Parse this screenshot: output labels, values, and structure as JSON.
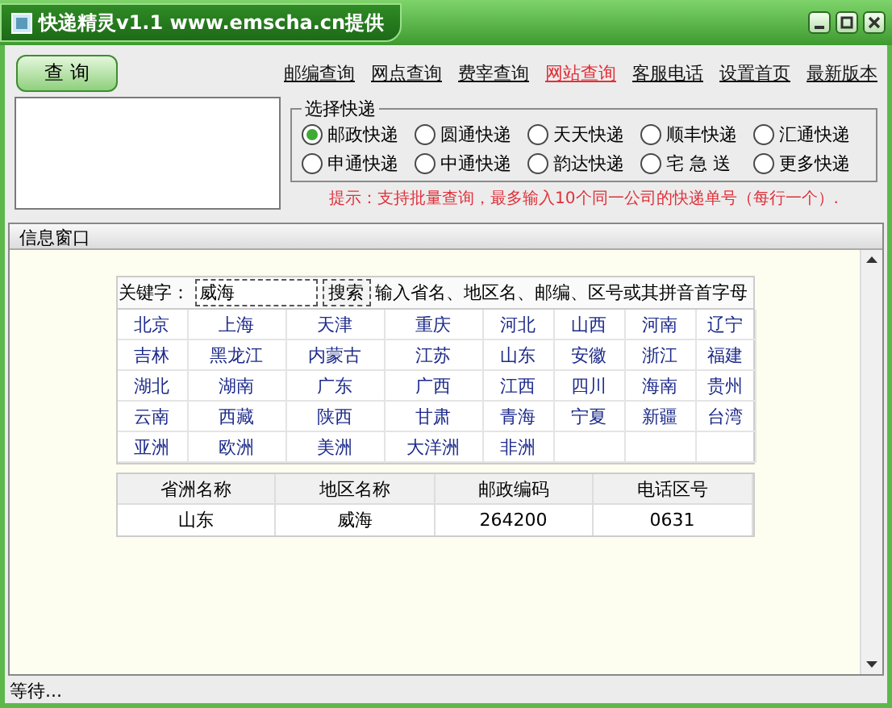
{
  "window": {
    "title": "快递精灵v1.1 www.emscha.cn提供"
  },
  "query_button": "查 询",
  "links": [
    {
      "label": "邮编查询",
      "selected": false
    },
    {
      "label": "网点查询",
      "selected": false
    },
    {
      "label": "费宰查询",
      "selected": false
    },
    {
      "label": "网站查询",
      "selected": true
    },
    {
      "label": "客服电话",
      "selected": false
    },
    {
      "label": "设置首页",
      "selected": false
    },
    {
      "label": "最新版本",
      "selected": false
    }
  ],
  "courier_group": {
    "title": "选择快递",
    "options": [
      {
        "label": "邮政快递",
        "selected": true
      },
      {
        "label": "圆通快递",
        "selected": false
      },
      {
        "label": "天天快递",
        "selected": false
      },
      {
        "label": "顺丰快递",
        "selected": false
      },
      {
        "label": "汇通快递",
        "selected": false
      },
      {
        "label": "申通快递",
        "selected": false
      },
      {
        "label": "中通快递",
        "selected": false
      },
      {
        "label": "韵达快递",
        "selected": false
      },
      {
        "label": "宅 急 送",
        "selected": false
      },
      {
        "label": "更多快递",
        "selected": false
      }
    ]
  },
  "hint": "提示：支持批量查询，最多输入10个同一公司的快递单号（每行一个）.",
  "info_window": {
    "title": "信息窗口",
    "search": {
      "label": "关键字：",
      "value": "威海",
      "button": "搜索",
      "help": "输入省名、地区名、邮编、区号或其拼音首字母"
    },
    "regions": [
      "北京",
      "上海",
      "天津",
      "重庆",
      "河北",
      "山西",
      "河南",
      "辽宁",
      "吉林",
      "黑龙江",
      "内蒙古",
      "江苏",
      "山东",
      "安徽",
      "浙江",
      "福建",
      "湖北",
      "湖南",
      "广东",
      "广西",
      "江西",
      "四川",
      "海南",
      "贵州",
      "云南",
      "西藏",
      "陕西",
      "甘肃",
      "青海",
      "宁夏",
      "新疆",
      "台湾",
      "亚洲",
      "欧洲",
      "美洲",
      "大洋洲",
      "非洲"
    ],
    "result": {
      "columns": [
        "省洲名称",
        "地区名称",
        "邮政编码",
        "电话区号"
      ],
      "rows": [
        [
          "山东",
          "威海",
          "264200",
          "0631"
        ]
      ]
    }
  },
  "status_bar": "等待..."
}
